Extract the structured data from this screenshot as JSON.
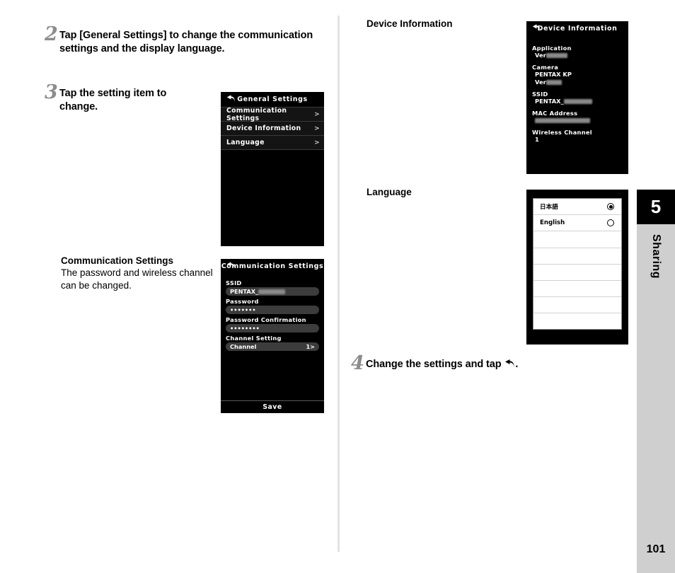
{
  "steps": [
    {
      "number": "2",
      "text": "Tap [General Settings] to change the communication settings and the display language."
    },
    {
      "number": "3",
      "text": "Tap the setting item to change."
    },
    {
      "number": "4",
      "text_before": "Change the settings and tap",
      "text_after": "."
    }
  ],
  "captions": {
    "communication_settings": {
      "title": "Communication Settings",
      "body": "The password and wireless channel can be changed."
    },
    "device_information": {
      "title": "Device Information"
    },
    "language": {
      "title": "Language"
    }
  },
  "screens": {
    "general_settings": {
      "title": "General Settings",
      "back_icon": "back-arrow-icon",
      "rows": [
        {
          "label": "Communication Settings",
          "chevron": ">"
        },
        {
          "label": "Device Information",
          "chevron": ">"
        },
        {
          "label": "Language",
          "chevron": ">"
        }
      ]
    },
    "communication_settings": {
      "title": "Communication Settings",
      "back_icon": "back-arrow-icon",
      "fields": [
        {
          "label": "SSID",
          "value": "PENTAX_",
          "redacted": true
        },
        {
          "label": "Password",
          "value": "•••••••",
          "redacted": false
        },
        {
          "label": "Password Confirmation",
          "value": "••••••••",
          "redacted": false
        }
      ],
      "channel_section_label": "Channel Setting",
      "channel_row": {
        "label": "Channel",
        "value": "1>"
      },
      "save_label": "Save"
    },
    "device_information": {
      "title": "Device Information",
      "back_icon": "back-arrow-icon",
      "entries": [
        {
          "key": "Application",
          "value": "Ver",
          "redacted": true
        },
        {
          "key": "Camera",
          "value": "PENTAX KP",
          "redacted": false
        },
        {
          "key": "",
          "value": "Ver",
          "redacted": true
        },
        {
          "key": "SSID",
          "value": "PENTAX_",
          "redacted": true
        },
        {
          "key": "MAC Address",
          "value": "",
          "redacted": true
        },
        {
          "key": "Wireless Channel",
          "value": "1",
          "redacted": false
        }
      ]
    },
    "language": {
      "options": [
        {
          "label": "日本語",
          "selected": true
        },
        {
          "label": "English",
          "selected": false
        }
      ],
      "empty_rows": 6
    }
  },
  "rail": {
    "chapter_number": "5",
    "chapter_title": "Sharing",
    "page_number": "101"
  }
}
